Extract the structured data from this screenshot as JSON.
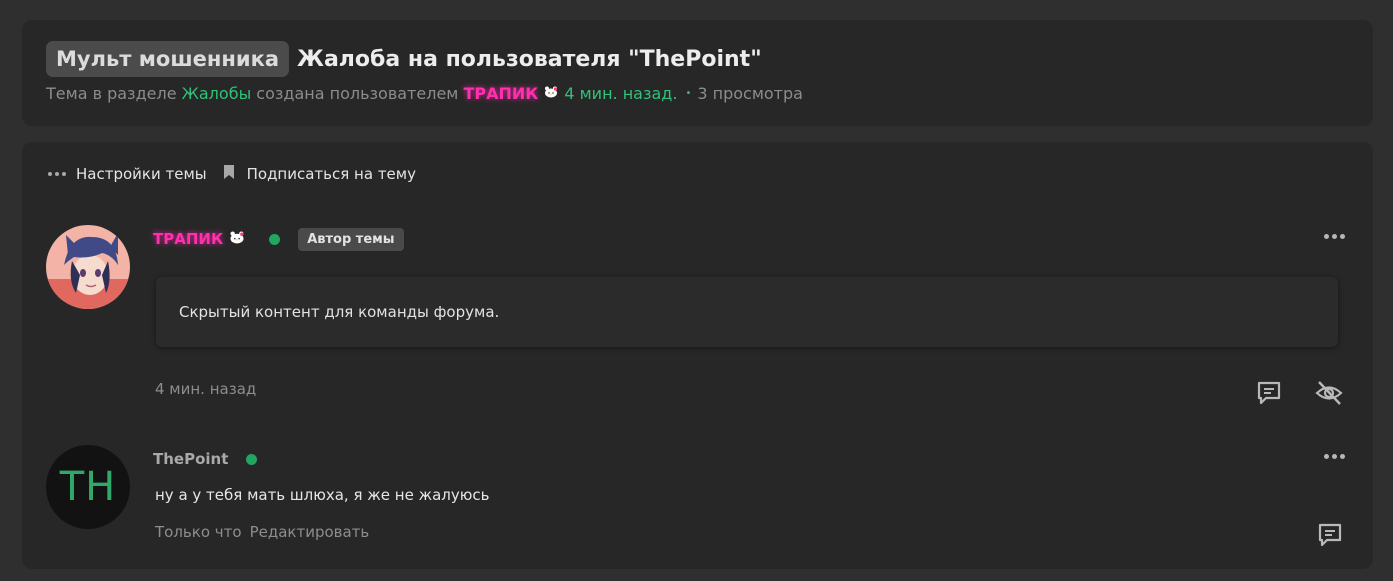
{
  "header": {
    "prefix": "Мульт мошенника",
    "title": "Жалоба на пользователя \"ThePoint\"",
    "meta": {
      "text_before": "Тема в разделе",
      "section": "Жалобы",
      "text_middle": "созданa пользователем",
      "author": "ТРАПИК",
      "time": "4 мин. назад.",
      "views": "3 просмотра"
    }
  },
  "actions": {
    "settings_label": "Настройки темы",
    "subscribe_label": "Подписаться на тему"
  },
  "posts": [
    {
      "author": "ТРАПИК",
      "badge": "Автор темы",
      "content": "Скрытый контент для команды форума.",
      "time": "4 мин. назад"
    },
    {
      "author": "ThePoint",
      "avatar_letters": "TH",
      "content": "ну а у тебя мать шлюха, я же не жалуюсь",
      "time": "Только что",
      "edit_label": "Редактировать"
    }
  ],
  "colors": {
    "background": "#2f2f2f",
    "card": "#272727",
    "accent_green": "#2fc27a",
    "nick_pink": "#ff2fb0",
    "online": "#23a562"
  },
  "icons": [
    "ellipsis-icon",
    "bookmark-icon",
    "online-indicator",
    "reply-icon",
    "eye-off-icon",
    "hello-kitty-icon"
  ]
}
